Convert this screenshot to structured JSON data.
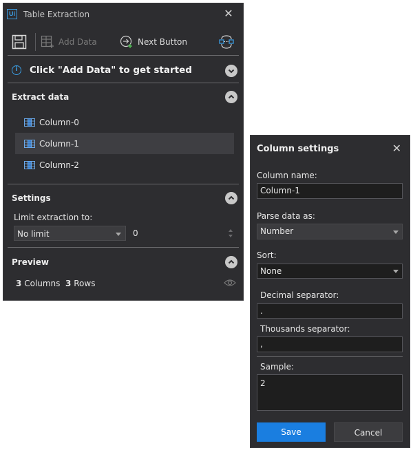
{
  "window": {
    "title": "Table Extraction",
    "logo_text": "Ui",
    "close_icon": "close-icon"
  },
  "toolbar": {
    "save_icon": "floppy-disk-icon",
    "add_data_label": "Add Data",
    "next_button_label": "Next Button",
    "extra_icon": "flow-icon"
  },
  "info": {
    "text": "Click \"Add Data\" to get started"
  },
  "extract": {
    "title": "Extract data",
    "columns": [
      {
        "label": "Column-0",
        "selected": false
      },
      {
        "label": "Column-1",
        "selected": true
      },
      {
        "label": "Column-2",
        "selected": false
      }
    ]
  },
  "settings": {
    "title": "Settings",
    "limit_label": "Limit extraction to:",
    "limit_selected": "No limit",
    "limit_value": "0"
  },
  "preview": {
    "title": "Preview",
    "columns_count": "3",
    "columns_word": "Columns",
    "rows_count": "3",
    "rows_word": "Rows"
  },
  "column_settings": {
    "title": "Column settings",
    "name_label": "Column name:",
    "name_value": "Column-1",
    "parse_label": "Parse data as:",
    "parse_value": "Number",
    "sort_label": "Sort:",
    "sort_value": "None",
    "decimal_label": "Decimal separator:",
    "decimal_value": ".",
    "thousands_label": "Thousands separator:",
    "thousands_value": ",",
    "sample_label": "Sample:",
    "sample_value": "2",
    "save_label": "Save",
    "cancel_label": "Cancel"
  },
  "colors": {
    "accent": "#1a7ee0",
    "panel_bg": "#2d2d30",
    "info_blue": "#3a9be0"
  }
}
